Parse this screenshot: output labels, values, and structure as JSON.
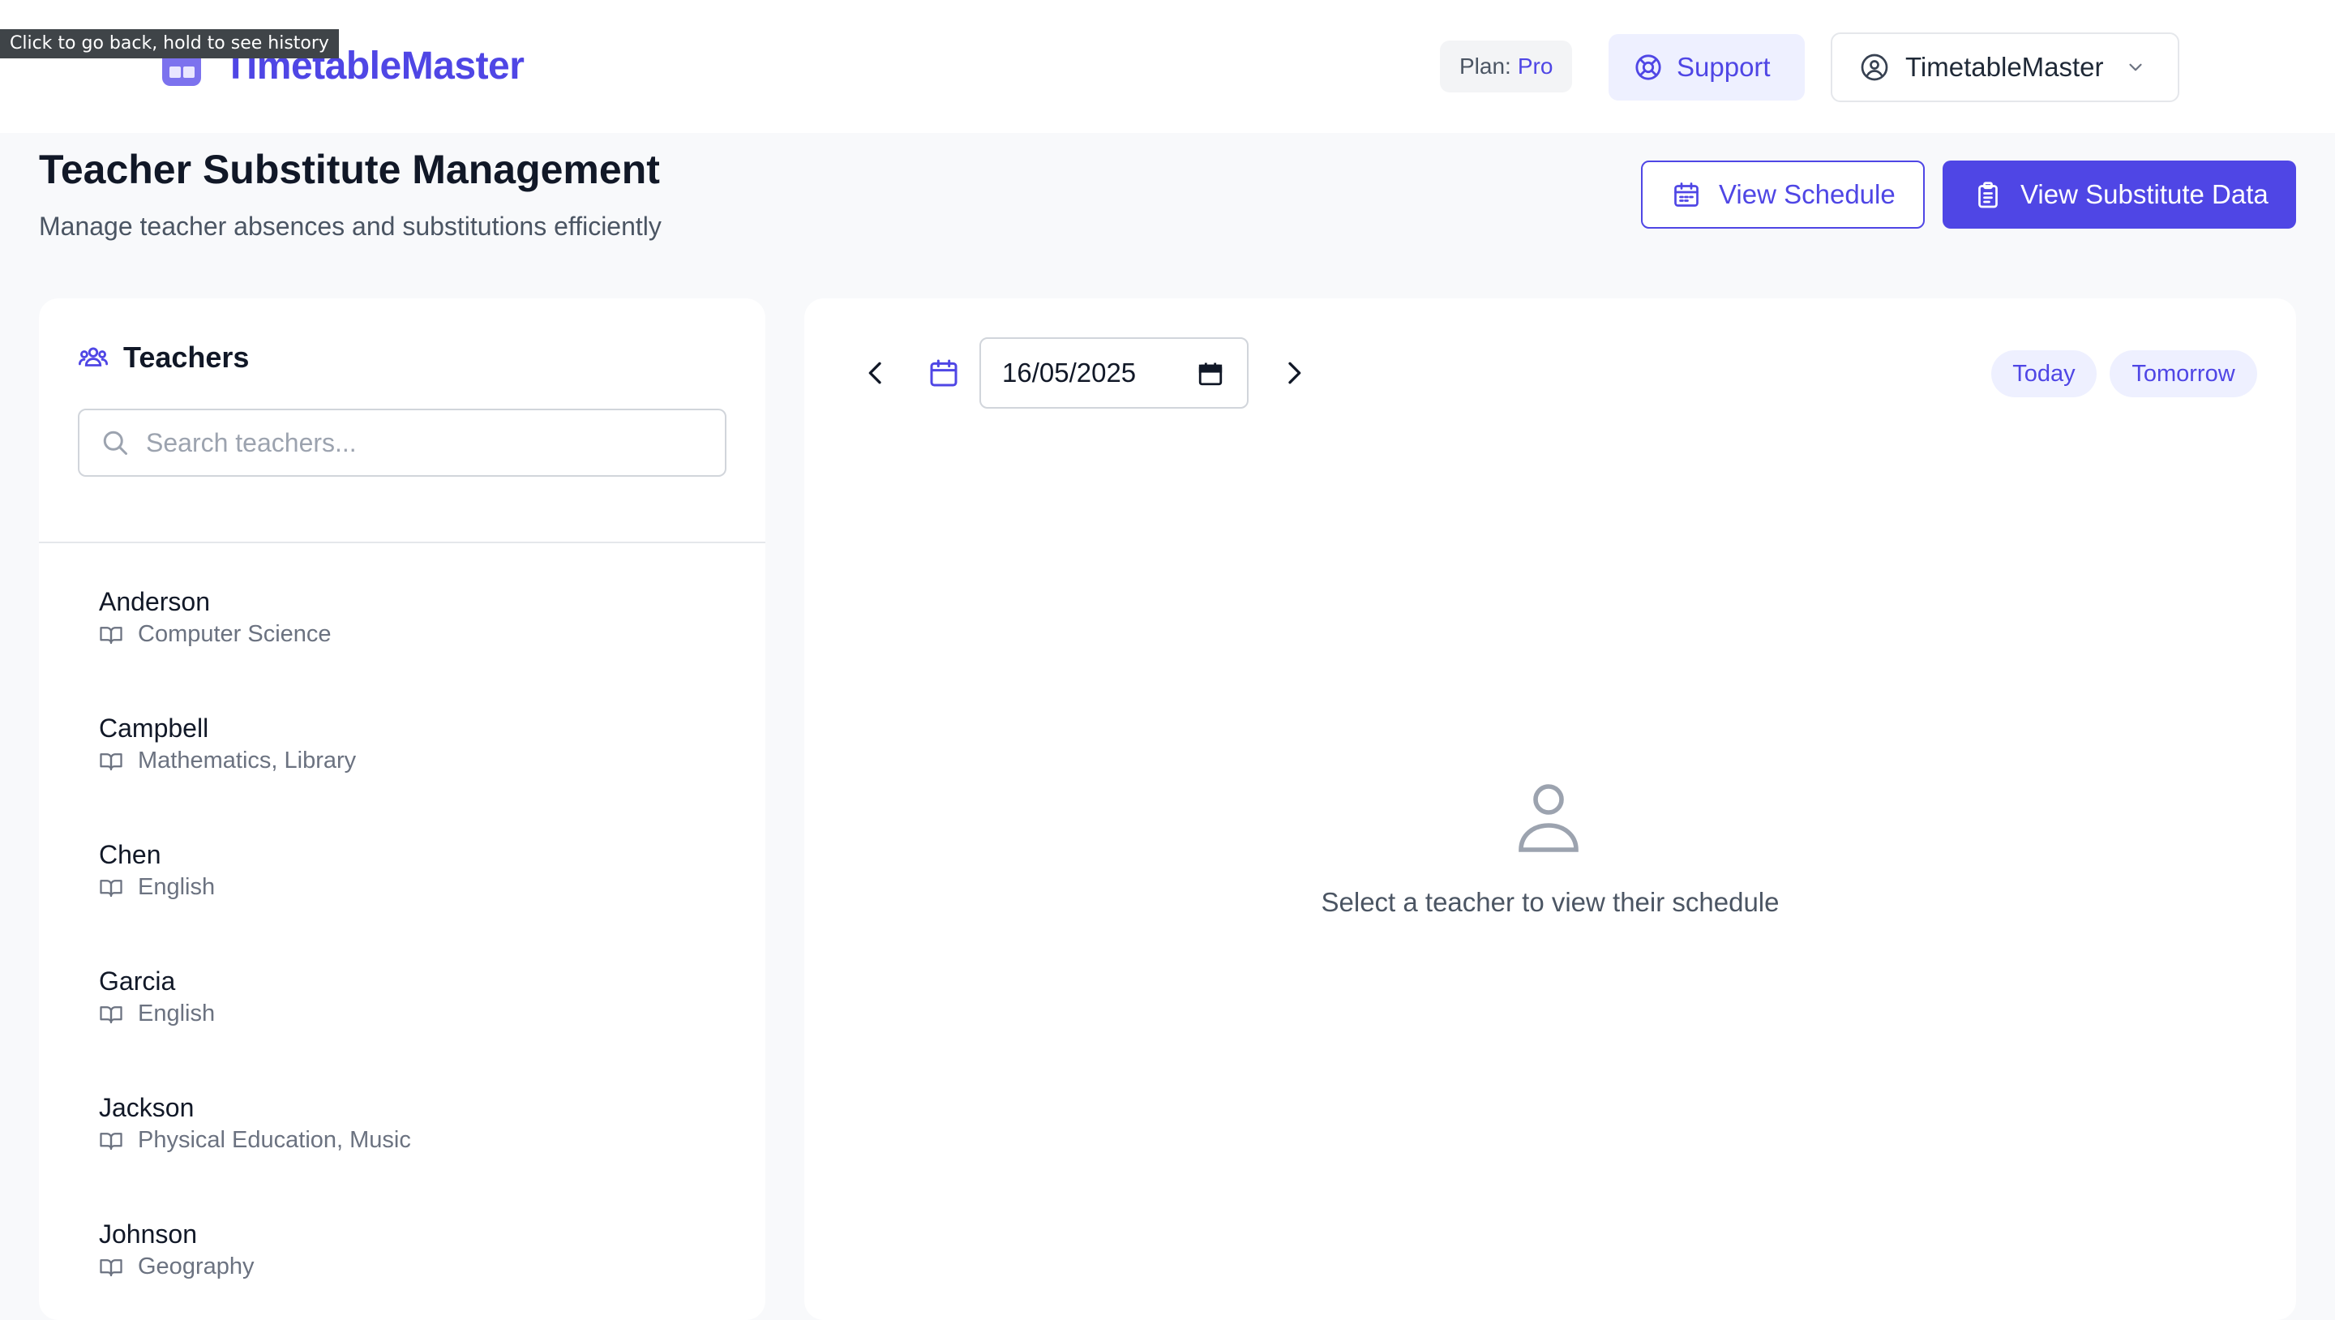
{
  "tooltip": "Click to go back, hold to see history",
  "header": {
    "app_name": "TimetableMaster",
    "plan_label": "Plan:",
    "plan_value": "Pro",
    "support_label": "Support",
    "account_name": "TimetableMaster"
  },
  "page": {
    "title": "Teacher Substitute Management",
    "subtitle": "Manage teacher absences and substitutions efficiently",
    "view_schedule_label": "View Schedule",
    "view_substitute_label": "View Substitute Data"
  },
  "teachers": {
    "heading": "Teachers",
    "search_placeholder": "Search teachers...",
    "items": [
      {
        "name": "Anderson",
        "subjects": "Computer Science"
      },
      {
        "name": "Campbell",
        "subjects": "Mathematics, Library"
      },
      {
        "name": "Chen",
        "subjects": "English"
      },
      {
        "name": "Garcia",
        "subjects": "English"
      },
      {
        "name": "Jackson",
        "subjects": "Physical Education, Music"
      },
      {
        "name": "Johnson",
        "subjects": "Geography"
      }
    ]
  },
  "schedule": {
    "date_value": "16/05/2025",
    "today_label": "Today",
    "tomorrow_label": "Tomorrow",
    "empty_message": "Select a teacher to view their schedule"
  },
  "icons": {
    "logo": "calendar-grid-icon",
    "support": "lifebuoy-icon",
    "account": "user-circle-icon",
    "dropdown": "chevron-down-icon",
    "view_schedule": "calendar-icon",
    "view_substitute": "clipboard-icon",
    "teachers": "users-icon",
    "search": "search-icon",
    "subject": "book-open-icon",
    "prev": "chevron-left-icon",
    "next": "chevron-right-icon",
    "empty_state": "user-icon"
  },
  "colors": {
    "accent": "#4f46e5",
    "accent_light": "#eef0ff",
    "background": "#f8f9fb"
  }
}
